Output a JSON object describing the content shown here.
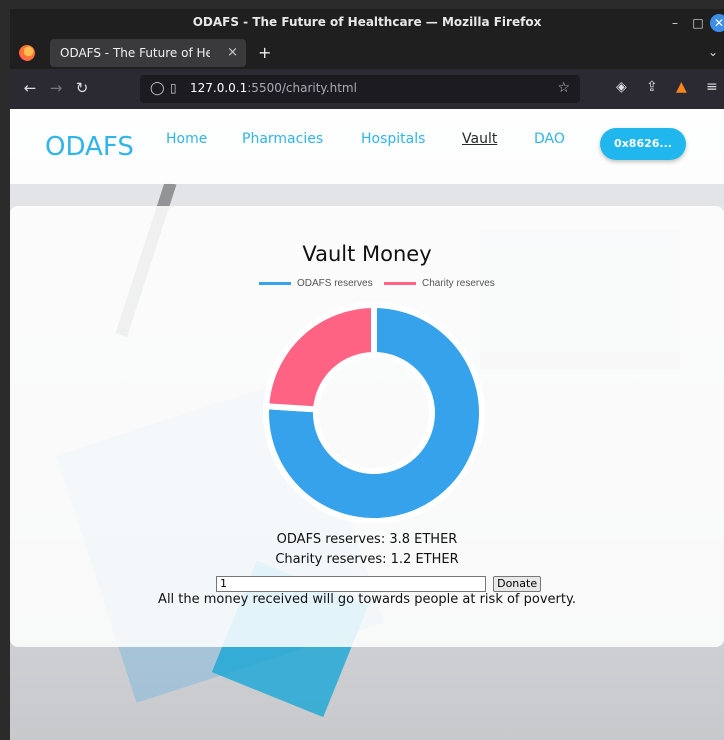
{
  "window": {
    "title": "ODAFS - The Future of Healthcare — Mozilla Firefox"
  },
  "tab": {
    "label": "ODAFS - The Future of Healt",
    "close": "×",
    "new_tab": "+"
  },
  "url": {
    "host": "127.0.0.1",
    "rest": ":5500/charity.html"
  },
  "nav": {
    "logo": "ODAFS",
    "links": [
      "Home",
      "Pharmacies",
      "Hospitals",
      "Vault",
      "DAO"
    ],
    "wallet": "0x8626..."
  },
  "vault": {
    "title": "Vault Money",
    "odafs_line": "ODAFS reserves: 3.8 ETHER",
    "charity_line": "Charity reserves: 1.2 ETHER",
    "amount_value": "1",
    "donate_label": "Donate",
    "note": "All the money received will go towards people at risk of poverty."
  },
  "chart_data": {
    "type": "pie",
    "title": "Vault Money",
    "categories": [
      "ODAFS reserves",
      "Charity reserves"
    ],
    "values": [
      3.8,
      1.2
    ],
    "colors": [
      "#36a2eb",
      "#ff6384"
    ],
    "legend": "top"
  }
}
